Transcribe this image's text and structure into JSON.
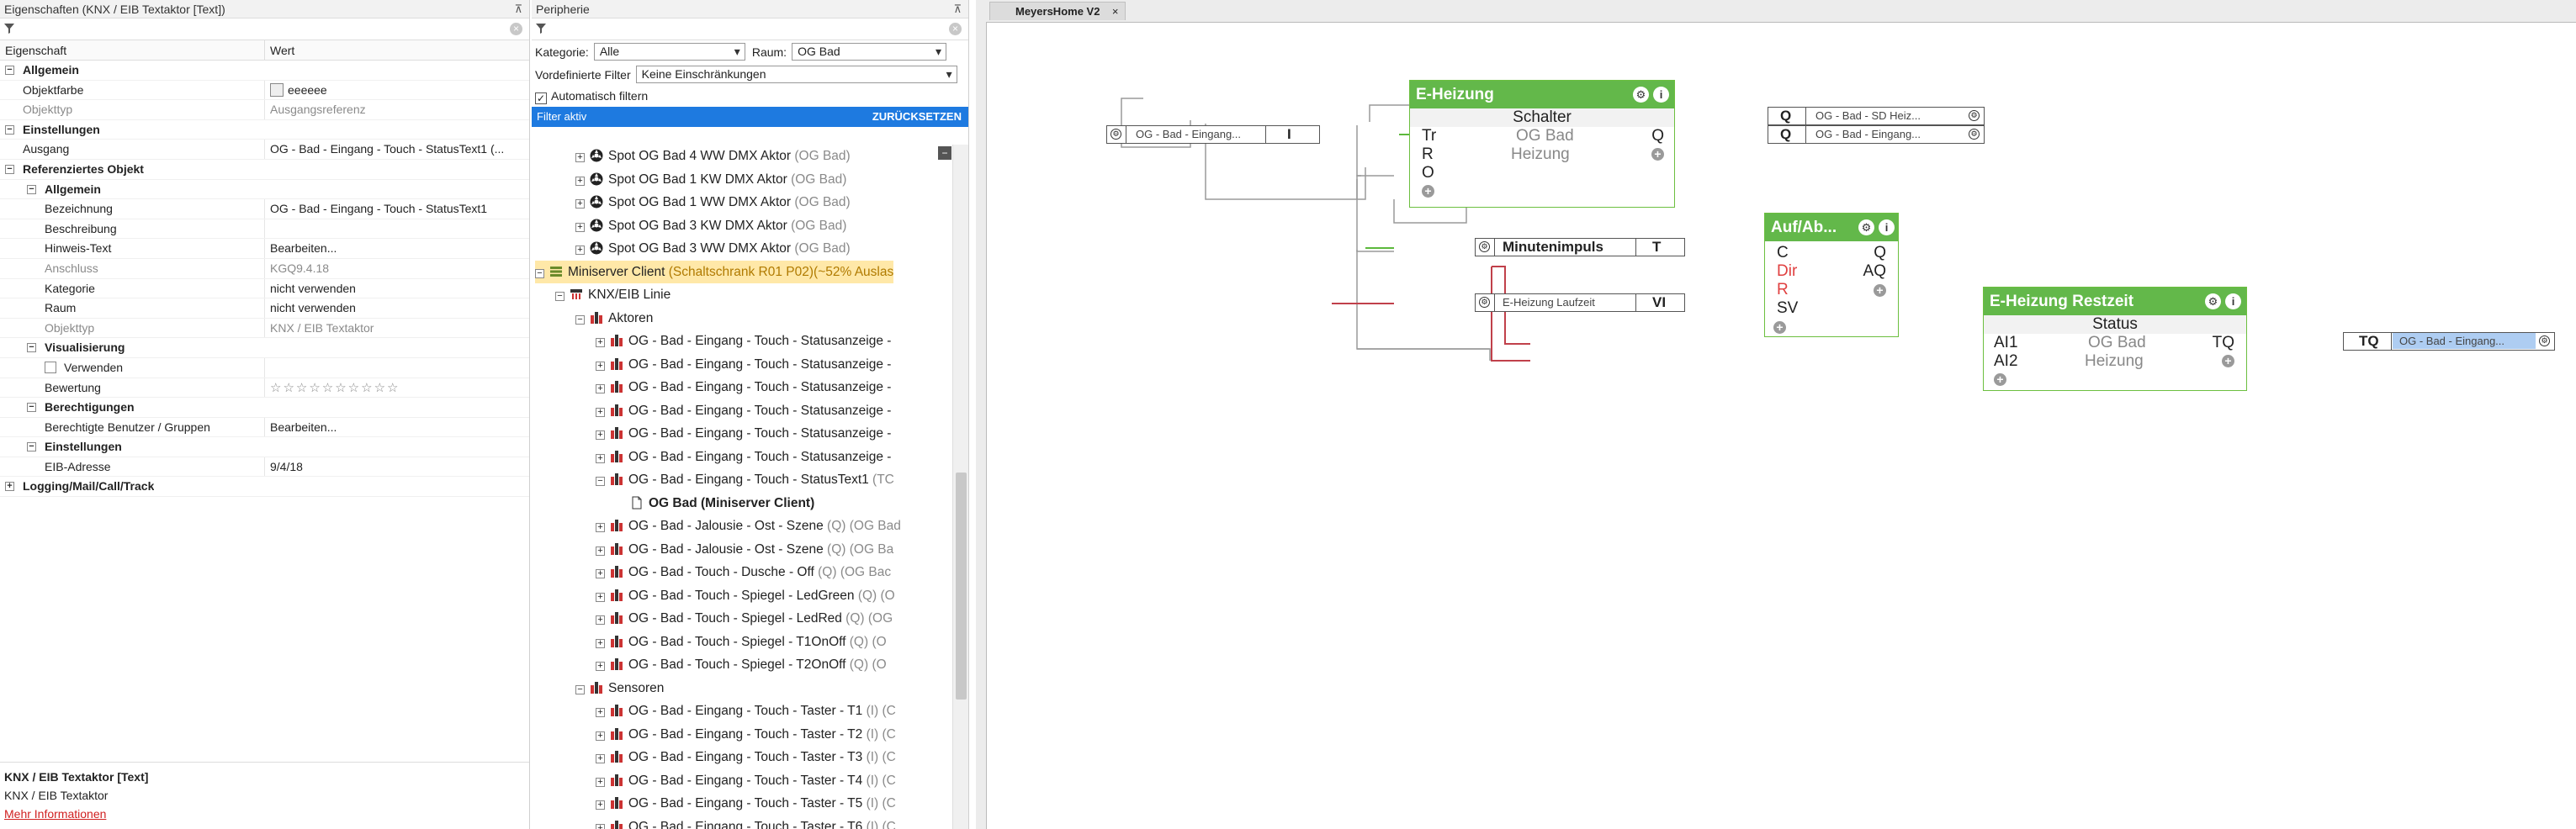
{
  "left": {
    "title": "Eigenschaften (KNX / EIB Textaktor [Text])",
    "col_prop": "Eigenschaft",
    "col_val": "Wert",
    "rows": [
      {
        "key": "Allgemein",
        "val": "",
        "type": "grp",
        "exp": "−"
      },
      {
        "key": "Objektfarbe",
        "val": "eeeeee",
        "type": "swatch"
      },
      {
        "key": "Objekttyp",
        "val": "Ausgangsreferenz",
        "type": "grey"
      },
      {
        "key": "Einstellungen",
        "val": "",
        "type": "grp",
        "exp": "−"
      },
      {
        "key": "Ausgang",
        "val": "OG - Bad - Eingang - Touch - StatusText1 (...",
        "type": "plain"
      },
      {
        "key": "Referenziertes Objekt",
        "val": "",
        "type": "grp",
        "exp": "−"
      },
      {
        "key": "Allgemein",
        "val": "",
        "type": "grp2",
        "exp": "−"
      },
      {
        "key": "Bezeichnung",
        "val": "OG - Bad - Eingang - Touch - StatusText1",
        "type": "l2"
      },
      {
        "key": "Beschreibung",
        "val": "",
        "type": "l2"
      },
      {
        "key": "Hinweis-Text",
        "val": "Bearbeiten...",
        "type": "l2"
      },
      {
        "key": "Anschluss",
        "val": "KGQ9.4.18",
        "type": "l2grey"
      },
      {
        "key": "Kategorie",
        "val": "nicht verwenden",
        "type": "l2"
      },
      {
        "key": "Raum",
        "val": "nicht verwenden",
        "type": "l2"
      },
      {
        "key": "Objekttyp",
        "val": "KNX / EIB Textaktor",
        "type": "l2grey"
      },
      {
        "key": "Visualisierung",
        "val": "",
        "type": "grp2",
        "exp": "−"
      },
      {
        "key": "Verwenden",
        "val": "",
        "type": "check"
      },
      {
        "key": "Bewertung",
        "val": "☆☆☆☆☆☆☆☆☆☆",
        "type": "stars"
      },
      {
        "key": "Berechtigungen",
        "val": "",
        "type": "grp2",
        "exp": "−"
      },
      {
        "key": "Berechtigte Benutzer / Gruppen",
        "val": "Bearbeiten...",
        "type": "l2"
      },
      {
        "key": "Einstellungen",
        "val": "",
        "type": "grp2",
        "exp": "−"
      },
      {
        "key": "EIB-Adresse",
        "val": "9/4/18",
        "type": "l2"
      },
      {
        "key": "Logging/Mail/Call/Track",
        "val": "",
        "type": "grp",
        "exp": "+"
      }
    ],
    "info_title": "KNX / EIB Textaktor [Text]",
    "info_sub": "KNX / EIB Textaktor",
    "info_link": "Mehr Informationen"
  },
  "mid": {
    "title": "Peripherie",
    "kategorie_label": "Kategorie:",
    "kategorie_value": "Alle",
    "raum_label": "Raum:",
    "raum_value": "OG Bad",
    "filter_label": "Vordefinierte Filter",
    "filter_value": "Keine Einschränkungen",
    "auto_filter": "Automatisch filtern",
    "active_label": "Filter aktiv",
    "reset_label": "ZURÜCKSETZEN",
    "tree": [
      {
        "indent": 3,
        "icon": "dmx",
        "label": "Spot OG Bad 4 WW DMX Aktor",
        "grey": " (OG Bad)",
        "exp": "+"
      },
      {
        "indent": 3,
        "icon": "dmx",
        "label": "Spot OG Bad 1 KW DMX Aktor",
        "grey": " (OG Bad)",
        "exp": "+"
      },
      {
        "indent": 3,
        "icon": "dmx",
        "label": "Spot OG Bad 1 WW DMX Aktor",
        "grey": " (OG Bad)",
        "exp": "+"
      },
      {
        "indent": 3,
        "icon": "dmx",
        "label": "Spot OG Bad 3 KW DMX Aktor",
        "grey": " (OG Bad)",
        "exp": "+"
      },
      {
        "indent": 3,
        "icon": "dmx",
        "label": "Spot OG Bad 3 WW DMX Aktor",
        "grey": " (OG Bad)",
        "exp": "+"
      },
      {
        "indent": 1,
        "icon": "server",
        "label": "Miniserver Client",
        "grey": " (Schaltschrank R01 P02)(~52% Auslas",
        "exp": "−",
        "hl": true
      },
      {
        "indent": 2,
        "icon": "knx",
        "label": "KNX/EIB Linie",
        "grey": "",
        "exp": "−"
      },
      {
        "indent": 3,
        "icon": "act",
        "label": "Aktoren",
        "grey": "",
        "exp": "−"
      },
      {
        "indent": 4,
        "icon": "act",
        "label": "OG - Bad - Eingang - Touch - Statusanzeige -",
        "grey": "",
        "exp": "+"
      },
      {
        "indent": 4,
        "icon": "act",
        "label": "OG - Bad - Eingang - Touch - Statusanzeige -",
        "grey": "",
        "exp": "+"
      },
      {
        "indent": 4,
        "icon": "act",
        "label": "OG - Bad - Eingang - Touch - Statusanzeige -",
        "grey": "",
        "exp": "+"
      },
      {
        "indent": 4,
        "icon": "act",
        "label": "OG - Bad - Eingang - Touch - Statusanzeige -",
        "grey": "",
        "exp": "+"
      },
      {
        "indent": 4,
        "icon": "act",
        "label": "OG - Bad - Eingang - Touch - Statusanzeige -",
        "grey": "",
        "exp": "+"
      },
      {
        "indent": 4,
        "icon": "act",
        "label": "OG - Bad - Eingang - Touch - Statusanzeige -",
        "grey": "",
        "exp": "+"
      },
      {
        "indent": 4,
        "icon": "act",
        "label": "OG - Bad - Eingang - Touch - StatusText1",
        "grey": " (TC",
        "exp": "−"
      },
      {
        "indent": 5,
        "icon": "doc",
        "label": "OG Bad (Miniserver Client)",
        "grey": "",
        "exp": "",
        "bold": true
      },
      {
        "indent": 4,
        "icon": "act",
        "label": "OG - Bad - Jalousie - Ost - Szene",
        "grey": " (Q) (OG Bad",
        "exp": "+"
      },
      {
        "indent": 4,
        "icon": "act",
        "label": "OG - Bad - Jalousie - Ost - Szene",
        "grey": " (Q) (OG Ba",
        "exp": "+"
      },
      {
        "indent": 4,
        "icon": "act",
        "label": "OG - Bad - Touch - Dusche - Off",
        "grey": " (Q) (OG Bac",
        "exp": "+"
      },
      {
        "indent": 4,
        "icon": "act",
        "label": "OG - Bad - Touch - Spiegel - LedGreen",
        "grey": " (Q) (O",
        "exp": "+"
      },
      {
        "indent": 4,
        "icon": "act",
        "label": "OG - Bad - Touch - Spiegel - LedRed",
        "grey": " (Q) (OG",
        "exp": "+"
      },
      {
        "indent": 4,
        "icon": "act",
        "label": "OG - Bad - Touch - Spiegel - T1OnOff",
        "grey": " (Q) (O",
        "exp": "+"
      },
      {
        "indent": 4,
        "icon": "act",
        "label": "OG - Bad - Touch - Spiegel - T2OnOff",
        "grey": " (Q) (O",
        "exp": "+"
      },
      {
        "indent": 3,
        "icon": "sens",
        "label": "Sensoren",
        "grey": "",
        "exp": "−"
      },
      {
        "indent": 4,
        "icon": "act",
        "label": "OG - Bad - Eingang - Touch - Taster - T1",
        "grey": " (I) (C",
        "exp": "+"
      },
      {
        "indent": 4,
        "icon": "act",
        "label": "OG - Bad - Eingang - Touch - Taster - T2",
        "grey": " (I) (C",
        "exp": "+"
      },
      {
        "indent": 4,
        "icon": "act",
        "label": "OG - Bad - Eingang - Touch - Taster - T3",
        "grey": " (I) (C",
        "exp": "+"
      },
      {
        "indent": 4,
        "icon": "act",
        "label": "OG - Bad - Eingang - Touch - Taster - T4",
        "grey": " (I) (C",
        "exp": "+"
      },
      {
        "indent": 4,
        "icon": "act",
        "label": "OG - Bad - Eingang - Touch - Taster - T5",
        "grey": " (I) (C",
        "exp": "+"
      },
      {
        "indent": 4,
        "icon": "act",
        "label": "OG - Bad - Eingang - Touch - Taster - T6",
        "grey": " (I) (C",
        "exp": "+"
      }
    ]
  },
  "canvas": {
    "tab": "MeyersHome V2",
    "tab_close": "×",
    "refs": {
      "in_eingang": {
        "text": "OG - Bad - Eingang...",
        "port": "I"
      },
      "minutenimpuls": {
        "text": "Minutenimpuls",
        "port": "T"
      },
      "laufzeit": {
        "text": "E-Heizung Laufzeit",
        "port": "VI"
      },
      "sd_heiz": {
        "text": "OG - Bad - SD Heiz...",
        "port": "Q"
      },
      "out_eingang": {
        "text": "OG - Bad - Eingang...",
        "port": "Q"
      },
      "tq_eingang": {
        "text": "OG - Bad - Eingang...",
        "port": "TQ"
      }
    },
    "heizung": {
      "title": "E-Heizung",
      "sub": "Schalter",
      "in1": "Tr",
      "in2": "R",
      "in3": "O",
      "room": "OG Bad",
      "cat": "Heizung",
      "out1": "Q"
    },
    "aufab": {
      "title": "Auf/Ab...",
      "in1": "C",
      "in2": "Dir",
      "in3": "R",
      "in4": "SV",
      "out1": "Q",
      "out2": "AQ"
    },
    "restzeit": {
      "title": "E-Heizung Restzeit",
      "sub": "Status",
      "in1": "AI1",
      "in2": "AI2",
      "room": "OG Bad",
      "cat": "Heizung",
      "out1": "TQ"
    },
    "gear": "⚙",
    "info": "i",
    "plus": "+",
    "colors": {
      "block": "#63b84a",
      "wire_green": "#5cb83c",
      "wire_red": "#c0404a",
      "wire_grey": "#999999",
      "highlight": "#aecdf2"
    }
  }
}
